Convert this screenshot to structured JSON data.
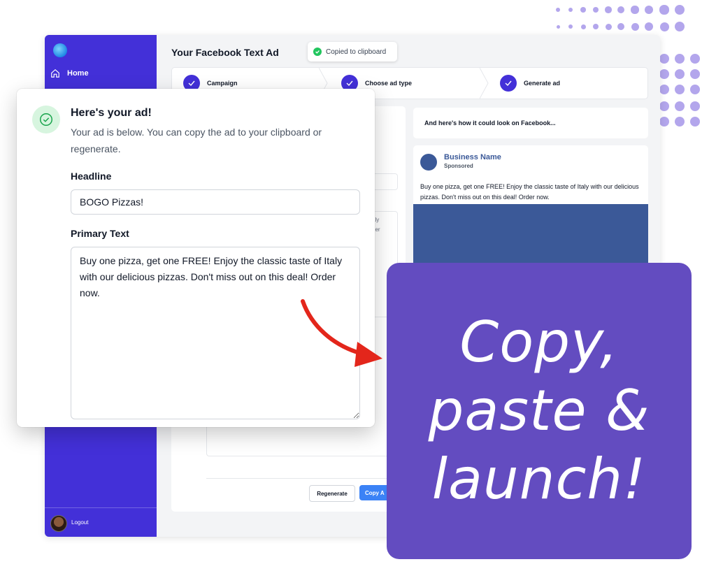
{
  "sidebar": {
    "home_label": "Home",
    "logout_label": "Logout"
  },
  "page": {
    "title": "Your Facebook Text Ad",
    "toast": "Copied to clipboard"
  },
  "steps": [
    {
      "label": "Campaign"
    },
    {
      "label": "Choose ad type"
    },
    {
      "label": "Generate ad"
    }
  ],
  "form_fragments": [
    "aly",
    "der"
  ],
  "buttons": {
    "regenerate": "Regenerate",
    "copy": "Copy A"
  },
  "preview": {
    "heading": "And here's how it could look on Facebook...",
    "business_name": "Business Name",
    "sponsored": "Sponsored",
    "text": "Buy one pizza, get one FREE! Enjoy the classic taste of Italy with our delicious pizzas. Don't miss out on this deal! Order now."
  },
  "modal": {
    "title": "Here's your ad!",
    "description": "Your ad is below. You can copy the ad to your clipboard or regenerate.",
    "headline_label": "Headline",
    "headline_value": "BOGO Pizzas!",
    "primary_text_label": "Primary Text",
    "primary_text_value": "Buy one pizza, get one FREE! Enjoy the classic taste of Italy with our delicious pizzas. Don't miss out on this deal! Order now."
  },
  "callout": {
    "line1": "Copy,",
    "line2": "paste &",
    "line3": "launch!"
  },
  "colors": {
    "sidebar": "#4330d8",
    "accent_button": "#3b82f6",
    "facebook_blue": "#3b5998",
    "callout": "#634cc0",
    "success_green": "#22c55e",
    "arrow_red": "#e3261b"
  },
  "icons": [
    "app-logo-icon",
    "home-icon",
    "check-circle-icon",
    "step-check-icon",
    "red-arrow-icon"
  ]
}
